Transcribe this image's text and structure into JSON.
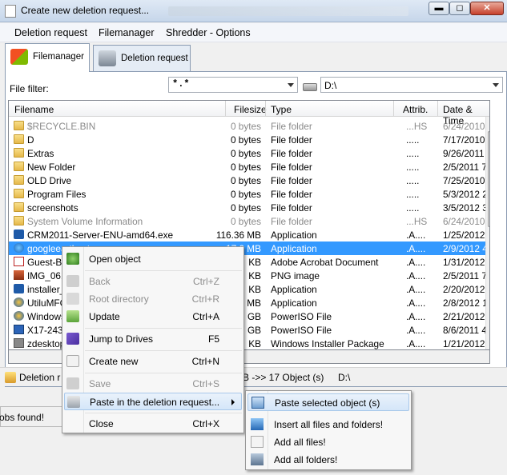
{
  "window": {
    "title": "Create new deletion request..."
  },
  "titlebar": {
    "min_glyph": "▬",
    "max_glyph": "◻",
    "close_glyph": "✕"
  },
  "menubar": {
    "items": [
      "Deletion request",
      "Filemanager",
      "Shredder - Options"
    ]
  },
  "tabs": [
    {
      "label": "Filemanager"
    },
    {
      "label": "Deletion request"
    }
  ],
  "filter": {
    "label": "File filter:",
    "value": "*.*"
  },
  "drive": {
    "value": "D:\\"
  },
  "columns": [
    "Filename",
    "Filesize",
    "Type",
    "Attrib.",
    "Date & Time"
  ],
  "rows": [
    {
      "name": "$RECYCLE.BIN",
      "size": "0 bytes",
      "type": "File folder",
      "attr": "...HS",
      "date": "6/24/2010"
    },
    {
      "name": "D",
      "size": "0 bytes",
      "type": "File folder",
      "attr": ".....",
      "date": "7/17/2010"
    },
    {
      "name": "Extras",
      "size": "0 bytes",
      "type": "File folder",
      "attr": ".....",
      "date": "9/26/2011"
    },
    {
      "name": "New Folder",
      "size": "0 bytes",
      "type": "File folder",
      "attr": ".....",
      "date": "2/5/2011 7"
    },
    {
      "name": "OLD Drive",
      "size": "0 bytes",
      "type": "File folder",
      "attr": ".....",
      "date": "7/25/2010"
    },
    {
      "name": "Program Files",
      "size": "0 bytes",
      "type": "File folder",
      "attr": ".....",
      "date": "5/3/2012 2"
    },
    {
      "name": "screenshots",
      "size": "0 bytes",
      "type": "File folder",
      "attr": ".....",
      "date": "3/5/2012 3"
    },
    {
      "name": "System Volume Information",
      "size": "0 bytes",
      "type": "File folder",
      "attr": "...HS",
      "date": "6/24/2010"
    },
    {
      "name": "CRM2011-Server-ENU-amd64.exe",
      "size": "116.36 MB",
      "type": "Application",
      "attr": ".A....",
      "date": "1/25/2012"
    },
    {
      "name": "googleearthsetup.exe",
      "size": "17.0 MB",
      "type": "Application",
      "attr": ".A....",
      "date": "2/9/2012 4"
    },
    {
      "name": "Guest-Bl",
      "size": "KB",
      "type": "Adobe Acrobat Document",
      "attr": ".A....",
      "date": "1/31/2012"
    },
    {
      "name": "IMG_061",
      "size": "KB",
      "type": "PNG image",
      "attr": ".A....",
      "date": "2/5/2011 7"
    },
    {
      "name": "installer_",
      "size": "KB",
      "type": "Application",
      "attr": ".A....",
      "date": "2/20/2012"
    },
    {
      "name": "UtiluMFC",
      "size": "MB",
      "type": "Application",
      "attr": ".A....",
      "date": "2/8/2012 1"
    },
    {
      "name": "Windows",
      "size": "GB",
      "type": "PowerISO File",
      "attr": ".A....",
      "date": "2/21/2012"
    },
    {
      "name": "X17-243",
      "size": "GB",
      "type": "PowerISO File",
      "attr": ".A....",
      "date": "8/6/2011 4"
    },
    {
      "name": "zdesktop",
      "size": "KB",
      "type": "Windows Installer Package",
      "attr": ".A....",
      "date": "1/21/2012"
    }
  ],
  "status": {
    "left": "Deletion r",
    "mid": "B ->> 17  Object (s)",
    "drive": "D:\\"
  },
  "bottom": {
    "text": "obs found!"
  },
  "context_menu": {
    "items": [
      {
        "label": "Open object",
        "shortcut": ""
      },
      {
        "label": "Back",
        "shortcut": "Ctrl+Z"
      },
      {
        "label": "Root directory",
        "shortcut": "Ctrl+R"
      },
      {
        "label": "Update",
        "shortcut": "Ctrl+A"
      },
      {
        "label": "Jump to Drives",
        "shortcut": "F5"
      },
      {
        "label": "Create new",
        "shortcut": "Ctrl+N"
      },
      {
        "label": "Save",
        "shortcut": "Ctrl+S"
      },
      {
        "label": "Paste in the deletion request...",
        "shortcut": ""
      },
      {
        "label": "Close",
        "shortcut": "Ctrl+X"
      }
    ]
  },
  "submenu": {
    "items": [
      {
        "label": "Paste selected object (s)"
      },
      {
        "label": "Insert all files and folders!"
      },
      {
        "label": "Add all files!"
      },
      {
        "label": "Add all folders!"
      }
    ]
  }
}
